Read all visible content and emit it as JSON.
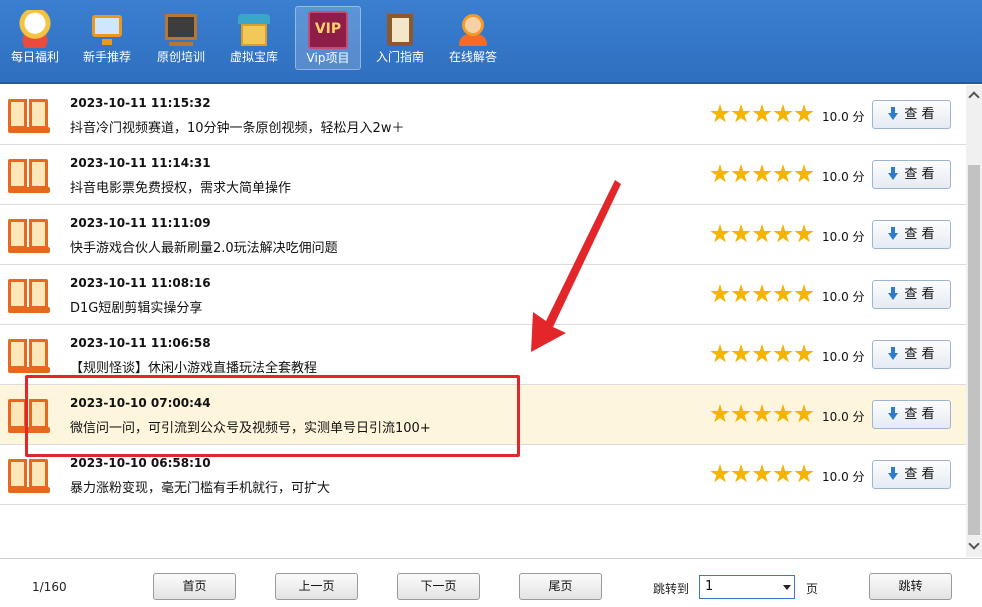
{
  "toolbar": {
    "items": [
      {
        "label": "每日福利",
        "icon": "lucky-cat-icon"
      },
      {
        "label": "新手推荐",
        "icon": "monitor-icon"
      },
      {
        "label": "原创培训",
        "icon": "blackboard-icon"
      },
      {
        "label": "虚拟宝库",
        "icon": "warehouse-icon"
      },
      {
        "label": "Vip项目",
        "icon": "vip-icon",
        "active": true,
        "badge": "VIP"
      },
      {
        "label": "入门指南",
        "icon": "book-icon"
      },
      {
        "label": "在线解答",
        "icon": "customer-service-icon"
      }
    ]
  },
  "list": {
    "rows": [
      {
        "date": "2023-10-11 11:15:32",
        "title": "抖音冷门视频赛道，10分钟一条原创视频，轻松月入2w＋",
        "rating": 5,
        "score": "10.0 分",
        "button": "查 看"
      },
      {
        "date": "2023-10-11 11:14:31",
        "title": "抖音电影票免费授权，需求大简单操作",
        "rating": 5,
        "score": "10.0 分",
        "button": "查 看"
      },
      {
        "date": "2023-10-11 11:11:09",
        "title": "快手游戏合伙人最新刷量2.0玩法解决吃佣问题",
        "rating": 5,
        "score": "10.0 分",
        "button": "查 看"
      },
      {
        "date": "2023-10-11 11:08:16",
        "title": "D1G短剧剪辑实操分享",
        "rating": 5,
        "score": "10.0 分",
        "button": "查 看"
      },
      {
        "date": "2023-10-11 11:06:58",
        "title": "【规则怪谈】休闲小游戏直播玩法全套教程",
        "rating": 5,
        "score": "10.0 分",
        "button": "查 看"
      },
      {
        "date": "2023-10-10 07:00:44",
        "title": "微信问一问，可引流到公众号及视频号，实测单号日引流100+",
        "rating": 5,
        "score": "10.0 分",
        "button": "查 看",
        "highlighted": true
      },
      {
        "date": "2023-10-10 06:58:10",
        "title": "暴力涨粉变现，毫无门槛有手机就行，可扩大",
        "rating": 5,
        "score": "10.0 分",
        "button": "查 看"
      }
    ]
  },
  "colors": {
    "toolbar": "#3a7fd0",
    "star": "#f5b400",
    "highlight_row": "#fdf5dc",
    "annotation": "#e3262a"
  },
  "footer": {
    "page_info": "1/160",
    "first": "首页",
    "prev": "上一页",
    "next": "下一页",
    "last": "尾页",
    "jump_label": "跳转到",
    "jump_value": "1",
    "page_unit": "页",
    "jump_button": "跳转"
  }
}
